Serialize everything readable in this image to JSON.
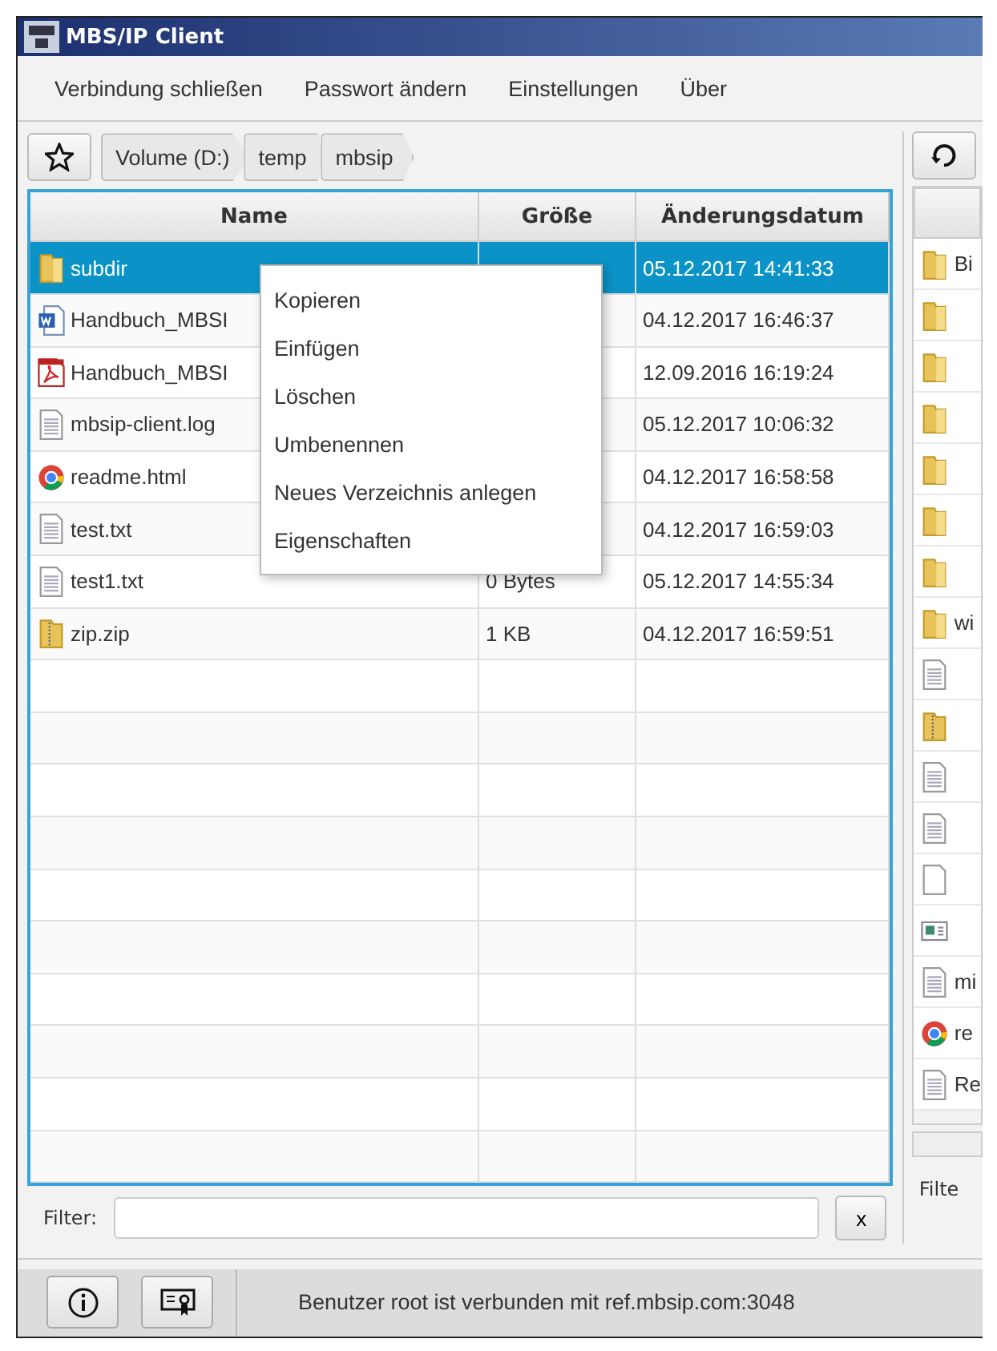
{
  "window": {
    "title": "MBS/IP Client"
  },
  "menu": [
    "Verbindung schließen",
    "Passwort ändern",
    "Einstellungen",
    "Über"
  ],
  "breadcrumb": [
    "Volume (D:)",
    "temp",
    "mbsip"
  ],
  "table": {
    "columns": [
      "Name",
      "Größe",
      "Änderungsdatum"
    ],
    "rows": [
      {
        "kind": "folder",
        "name": "subdir",
        "modified": "05.12.2017 14:41:33",
        "selected": true
      },
      {
        "kind": "word",
        "name": "Handbuch_MBSI",
        "modified": "04.12.2017 16:46:37",
        "selected": false
      },
      {
        "kind": "pdf",
        "name": "Handbuch_MBSI",
        "modified": "12.09.2016 16:19:24",
        "selected": false
      },
      {
        "kind": "text",
        "name": "mbsip-client.log",
        "modified": "05.12.2017 10:06:32",
        "selected": false
      },
      {
        "kind": "web",
        "name": "readme.html",
        "modified": "04.12.2017 16:58:58",
        "selected": false
      },
      {
        "kind": "text",
        "name": "test.txt",
        "modified": "04.12.2017 16:59:03",
        "selected": false
      },
      {
        "kind": "text",
        "name": "test1.txt",
        "size": "0 Bytes",
        "modified": "05.12.2017 14:55:34",
        "selected": false
      },
      {
        "kind": "zip",
        "name": "zip.zip",
        "size": "1 KB",
        "modified": "04.12.2017 16:59:51",
        "selected": false
      }
    ]
  },
  "context_menu": [
    "Kopieren",
    "Einfügen",
    "Löschen",
    "Umbenennen",
    "Neues Verzeichnis anlegen",
    "Eigenschaften"
  ],
  "filter": {
    "label": "Filter:",
    "clear": "x"
  },
  "right_pane": {
    "rows": [
      {
        "kind": "folder",
        "name": "Bi"
      },
      {
        "kind": "folder"
      },
      {
        "kind": "folder"
      },
      {
        "kind": "folder"
      },
      {
        "kind": "folder"
      },
      {
        "kind": "folder"
      },
      {
        "kind": "folder"
      },
      {
        "kind": "folder",
        "name": "wi"
      },
      {
        "kind": "text"
      },
      {
        "kind": "zip"
      },
      {
        "kind": "text"
      },
      {
        "kind": "text"
      },
      {
        "kind": "blank"
      },
      {
        "kind": "image"
      },
      {
        "kind": "text",
        "name": "mi"
      },
      {
        "kind": "web",
        "name": "re"
      },
      {
        "kind": "text",
        "name": "Re"
      }
    ],
    "filter_label": "Filte"
  },
  "status_bar": {
    "message": "Benutzer root ist verbunden mit ref.mbsip.com:3048"
  }
}
